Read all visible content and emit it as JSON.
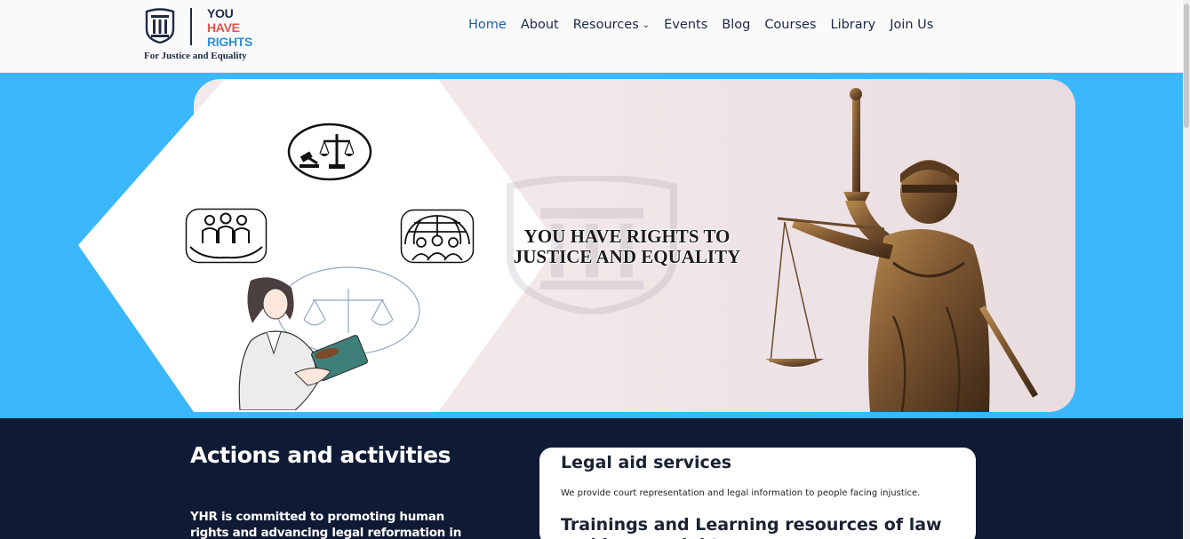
{
  "brand": {
    "mark_text": "YHR",
    "word_line1": "YOU",
    "word_line2": "HAVE",
    "word_line3": "RIGHTS",
    "tagline": "For Justice and Equality",
    "colors": {
      "navy": "#1f2a44",
      "red": "#e0524b",
      "blue": "#2f8fd8"
    }
  },
  "nav": {
    "items": [
      {
        "label": "Home",
        "active": true
      },
      {
        "label": "About",
        "active": false
      },
      {
        "label": "Resources",
        "active": false,
        "dropdown": true
      },
      {
        "label": "Events",
        "active": false
      },
      {
        "label": "Blog",
        "active": false
      },
      {
        "label": "Courses",
        "active": false
      },
      {
        "label": "Library",
        "active": false
      },
      {
        "label": "Join Us",
        "active": false
      }
    ],
    "dropdown_icon": "chevron-down-icon"
  },
  "hero": {
    "title_line1": "YOU HAVE RIGHTS TO",
    "title_line2": "JUSTICE AND EQUALITY",
    "band_color": "#3bb7fb",
    "icons": [
      "gavel-scales-icon",
      "community-care-icon",
      "global-people-icon",
      "lawyer-illustration",
      "lady-justice-statue"
    ]
  },
  "actions": {
    "title": "Actions and activities",
    "text": "YHR is committed to promoting human rights and advancing legal reformation in Myanmar",
    "background": "#0f1a35"
  },
  "services": {
    "legal_aid_title": "Legal aid services",
    "legal_aid_text": "We provide court representation and legal information to people facing injustice.",
    "training_title": "Trainings and Learning resources of law and human rights"
  }
}
